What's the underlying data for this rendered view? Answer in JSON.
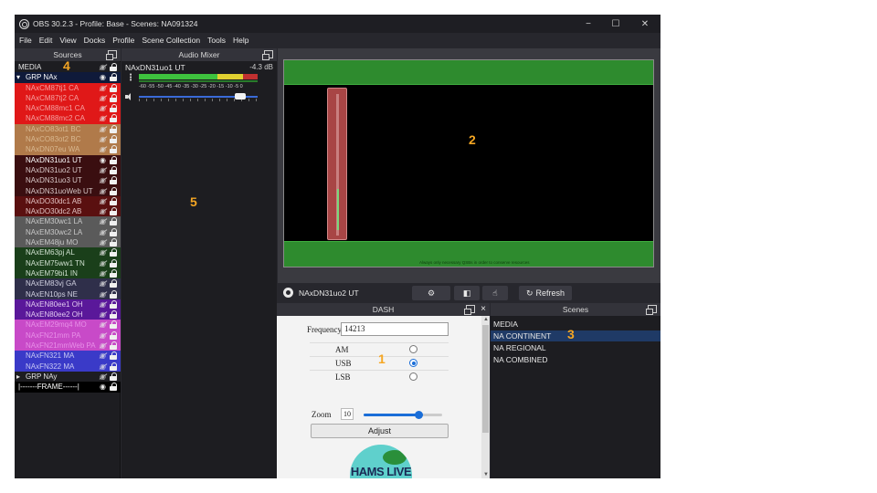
{
  "window": {
    "title": "OBS 30.2.3 - Profile: Base - Scenes: NA091324",
    "minimize": "−",
    "maximize": "☐",
    "close": "✕"
  },
  "menu": [
    "File",
    "Edit",
    "View",
    "Docks",
    "Profile",
    "Scene Collection",
    "Tools",
    "Help"
  ],
  "sources": {
    "title": "Sources",
    "items": [
      {
        "name": "MEDIA",
        "type": "plain",
        "bg": "#1d1d21",
        "fg": "#e6e6e6",
        "visible": false
      },
      {
        "name": "GRP NAx",
        "type": "group",
        "bg": "#0f1a3a",
        "fg": "#ffffff",
        "visible": true
      },
      {
        "name": "NAxCM87tj1  CA",
        "bg": "#e01818",
        "fg": "#f4a0a0",
        "visible": false
      },
      {
        "name": "NAxCM87tj2  CA",
        "bg": "#e01818",
        "fg": "#f4a0a0",
        "visible": false
      },
      {
        "name": "NAxCM88mc1  CA",
        "bg": "#e01818",
        "fg": "#f4a0a0",
        "visible": false
      },
      {
        "name": "NAxCM88mc2  CA",
        "bg": "#e01818",
        "fg": "#f4a0a0",
        "visible": false
      },
      {
        "name": "NAxCO83ot1  BC",
        "bg": "#b07a4a",
        "fg": "#d9b890",
        "visible": false
      },
      {
        "name": "NAxCO83ot2  BC",
        "bg": "#b07a4a",
        "fg": "#d9b890",
        "visible": false
      },
      {
        "name": "NAxDN07eu  WA",
        "bg": "#b07a4a",
        "fg": "#d9b890",
        "visible": false
      },
      {
        "name": "NAxDN31uo1  UT",
        "bg": "#3a0e10",
        "fg": "#ffffff",
        "visible": true
      },
      {
        "name": "NAxDN31uo2  UT",
        "bg": "#3a0e10",
        "fg": "#d8c8c8",
        "visible": false
      },
      {
        "name": "NAxDN31uo3  UT",
        "bg": "#3a0e10",
        "fg": "#d8c8c8",
        "visible": false
      },
      {
        "name": "NAxDN31uoWeb  UT",
        "bg": "#3a0e10",
        "fg": "#d8c8c8",
        "visible": false
      },
      {
        "name": "NAxDO30dc1  AB",
        "bg": "#5a1010",
        "fg": "#e0c0c0",
        "visible": false
      },
      {
        "name": "NAxDO30dc2  AB",
        "bg": "#5a1010",
        "fg": "#e0c0c0",
        "visible": false
      },
      {
        "name": "NAxEM30wc1  LA",
        "bg": "#5a5a5a",
        "fg": "#c8c8c8",
        "visible": false
      },
      {
        "name": "NAxEM30wc2  LA",
        "bg": "#5a5a5a",
        "fg": "#c8c8c8",
        "visible": false
      },
      {
        "name": "NAxEM48ju  MO",
        "bg": "#5a5a5a",
        "fg": "#c8c8c8",
        "visible": false
      },
      {
        "name": "NAxEM63pj  AL",
        "bg": "#1a3f1a",
        "fg": "#cfe0cf",
        "visible": false
      },
      {
        "name": "NAxEM75ww1  TN",
        "bg": "#1a3f1a",
        "fg": "#cfe0cf",
        "visible": false
      },
      {
        "name": "NAxEM79bi1  IN",
        "bg": "#1a3f1a",
        "fg": "#cfe0cf",
        "visible": false
      },
      {
        "name": "NAxEM83vj  GA",
        "bg": "#2f2f4a",
        "fg": "#d0d0e0",
        "visible": false
      },
      {
        "name": "NAxEN10ps  NE",
        "bg": "#2f2f4a",
        "fg": "#d0d0e0",
        "visible": false
      },
      {
        "name": "NAxEN80ee1  OH",
        "bg": "#5a189a",
        "fg": "#e0c8f0",
        "visible": false
      },
      {
        "name": "NAxEN80ee2  OH",
        "bg": "#5a189a",
        "fg": "#e0c8f0",
        "visible": false
      },
      {
        "name": "NAxEM29mq4  MO",
        "bg": "#c84ac8",
        "fg": "#e890e8",
        "visible": false
      },
      {
        "name": "NAxFN21mm  PA",
        "bg": "#c84ac8",
        "fg": "#e890e8",
        "visible": false
      },
      {
        "name": "NAxFN21mmWeb  PA",
        "bg": "#c84ac8",
        "fg": "#e890e8",
        "visible": false
      },
      {
        "name": "NAxFN321  MA",
        "bg": "#3a3ac8",
        "fg": "#c8c8f4",
        "visible": false
      },
      {
        "name": "NAxFN322  MA",
        "bg": "#3a3ac8",
        "fg": "#c8c8f4",
        "visible": false
      },
      {
        "name": "GRP NAy",
        "type": "group-collapsed",
        "bg": "#1d1d21",
        "fg": "#e6e6e6",
        "visible": false
      },
      {
        "name": "|-------FRAME------|",
        "type": "plain",
        "bg": "#000000",
        "fg": "#ffffff",
        "visible": true
      }
    ]
  },
  "audio_mixer": {
    "title": "Audio Mixer",
    "channel": "NAxDN31uo1  UT",
    "level": "-4.3 dB",
    "scale": "-60  -55  -50  -45  -40  -35  -30  -25  -20  -15  -10   -5    0",
    "volume_fraction": 0.85
  },
  "preview": {
    "band_note": "Always only necessary QSBs in order to conserve resources",
    "source_name": "NAxDN31uo2  UT",
    "refresh_label": "Refresh"
  },
  "dash": {
    "title": "DASH",
    "frequency_label": "Frequency",
    "frequency_value": "14213",
    "modes": [
      {
        "label": "AM",
        "selected": false
      },
      {
        "label": "USB",
        "selected": true
      },
      {
        "label": "LSB",
        "selected": false
      }
    ],
    "zoom_label": "Zoom",
    "zoom_value": "10",
    "zoom_fraction": 0.7,
    "adjust_label": "Adjust",
    "logo_text": "HAMS LIVE"
  },
  "scenes": {
    "title": "Scenes",
    "items": [
      "MEDIA",
      "NA CONTINENT",
      "NA REGIONAL",
      "NA COMBINED"
    ],
    "selected_index": 1
  },
  "markers": [
    "1",
    "2",
    "3",
    "4",
    "5"
  ],
  "colors": {
    "accent": "#1a6ed8",
    "marker": "#f5a623",
    "selection": "#1f3a66"
  }
}
